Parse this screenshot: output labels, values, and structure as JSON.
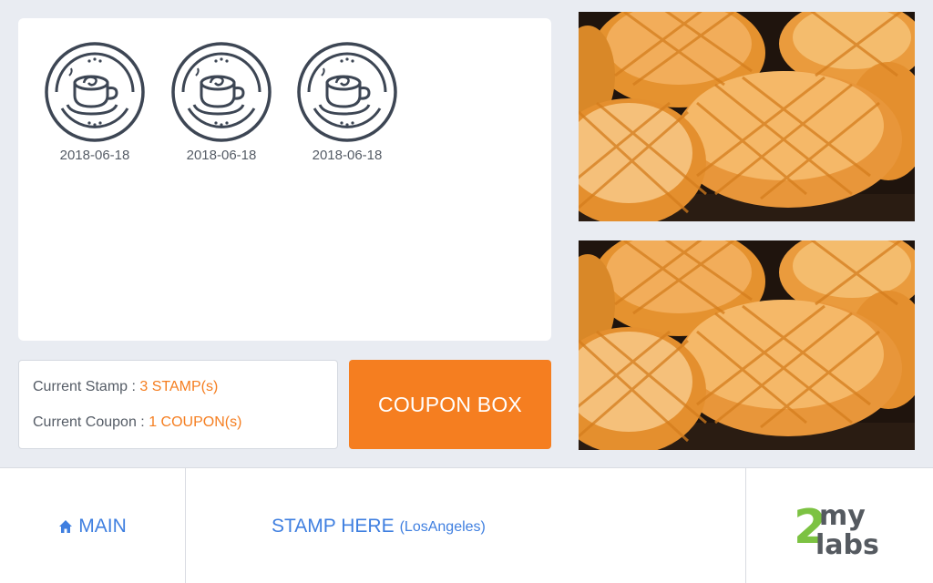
{
  "stamps": [
    {
      "date": "2018-06-18",
      "icon": "coffee-cup-icon"
    },
    {
      "date": "2018-06-18",
      "icon": "coffee-cup-icon"
    },
    {
      "date": "2018-06-18",
      "icon": "coffee-cup-icon"
    }
  ],
  "info": {
    "stamp_label": "Current Stamp : ",
    "stamp_value": "3 STAMP(s)",
    "coupon_label": "Current Coupon : ",
    "coupon_value": "1 COUPON(s)"
  },
  "coupon_box_label": "COUPON BOX",
  "footer": {
    "main_label": "MAIN",
    "main_icon": "home-icon",
    "stamp_here_label": "STAMP HERE",
    "location": "(LosAngeles)",
    "logo_text_number": "2",
    "logo_text_top": "my",
    "logo_text_bottom": "labs"
  },
  "colors": {
    "accent_orange": "#f57e20",
    "link_blue": "#3f7fe0",
    "logo_green": "#7cc242",
    "logo_gray": "#555a60"
  },
  "images": [
    {
      "name": "bread-photo-top",
      "subject": "pineapple buns"
    },
    {
      "name": "bread-photo-bottom",
      "subject": "pineapple buns"
    }
  ]
}
